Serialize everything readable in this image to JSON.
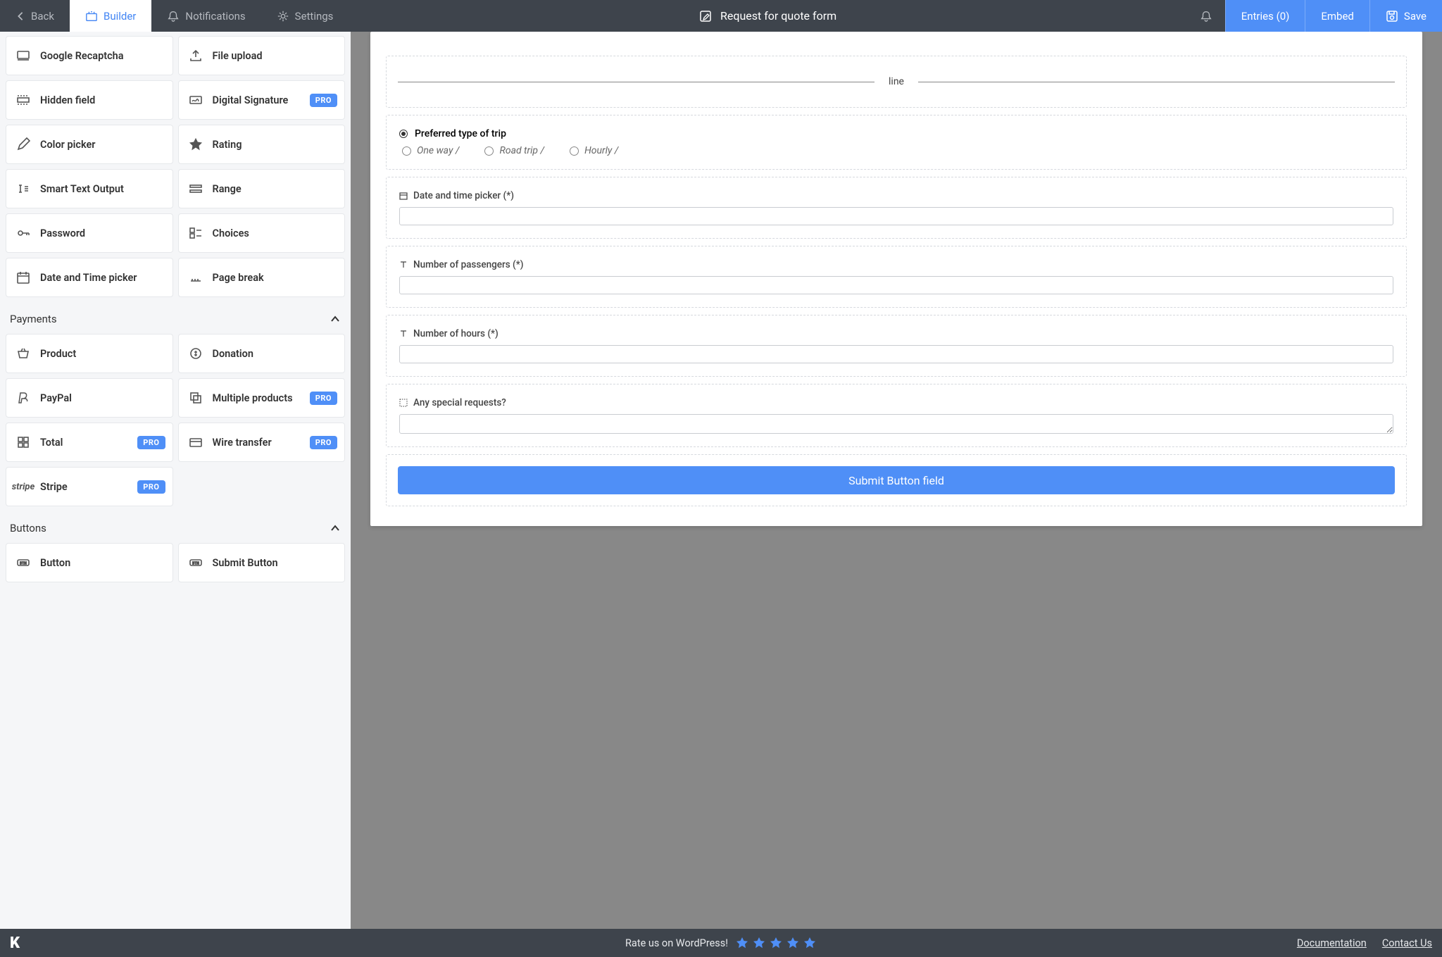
{
  "topbar": {
    "back": "Back",
    "builder": "Builder",
    "notifications": "Notifications",
    "settings": "Settings",
    "title": "Request for quote form",
    "entries": "Entries (0)",
    "embed": "Embed",
    "save": "Save"
  },
  "sidebar": {
    "fields": [
      {
        "label": "Google Recaptcha",
        "icon": "recaptcha",
        "pro": false
      },
      {
        "label": "File upload",
        "icon": "upload",
        "pro": false
      },
      {
        "label": "Hidden field",
        "icon": "hidden",
        "pro": false
      },
      {
        "label": "Digital Signature",
        "icon": "signature",
        "pro": true
      },
      {
        "label": "Color picker",
        "icon": "pencil",
        "pro": false
      },
      {
        "label": "Rating",
        "icon": "star",
        "pro": false
      },
      {
        "label": "Smart Text Output",
        "icon": "smart-text",
        "pro": false
      },
      {
        "label": "Range",
        "icon": "range",
        "pro": false
      },
      {
        "label": "Password",
        "icon": "key",
        "pro": false
      },
      {
        "label": "Choices",
        "icon": "choices",
        "pro": false
      },
      {
        "label": "Date and Time picker",
        "icon": "datetime",
        "pro": false
      },
      {
        "label": "Page break",
        "icon": "pagebreak",
        "pro": false
      }
    ],
    "payments_header": "Payments",
    "payments": [
      {
        "label": "Product",
        "icon": "product",
        "pro": false
      },
      {
        "label": "Donation",
        "icon": "donation",
        "pro": false
      },
      {
        "label": "PayPal",
        "icon": "paypal",
        "pro": false
      },
      {
        "label": "Multiple products",
        "icon": "multi",
        "pro": true
      },
      {
        "label": "Total",
        "icon": "total",
        "pro": true
      },
      {
        "label": "Wire transfer",
        "icon": "card",
        "pro": true
      },
      {
        "label": "Stripe",
        "icon": "stripe",
        "pro": true
      }
    ],
    "buttons_header": "Buttons",
    "buttons": [
      {
        "label": "Button",
        "icon": "btn",
        "pro": false
      },
      {
        "label": "Submit Button",
        "icon": "btn",
        "pro": false
      }
    ],
    "pro_label": "PRO"
  },
  "form": {
    "line_label": "line",
    "trip": {
      "label": "Preferred type of trip",
      "options": [
        "One way /",
        "Road trip /",
        "Hourly /"
      ]
    },
    "datetime_label": "Date and time picker (*)",
    "passengers_label": "Number of passengers (*)",
    "hours_label": "Number of hours (*)",
    "requests_label": "Any special requests?",
    "submit_label": "Submit Button field"
  },
  "footer": {
    "rate": "Rate us on WordPress!",
    "docs": "Documentation",
    "contact": "Contact Us"
  }
}
